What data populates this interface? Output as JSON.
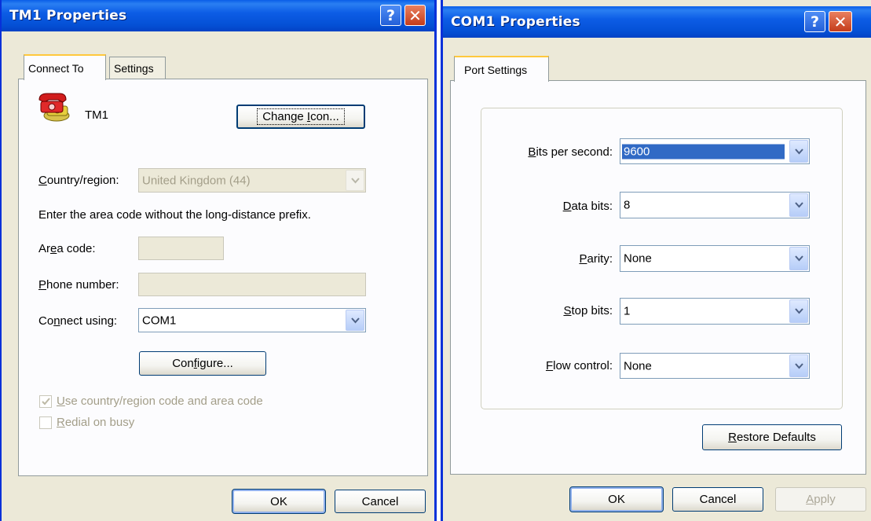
{
  "dialog1": {
    "title": "TM1 Properties",
    "tabs": [
      {
        "label": "Connect To",
        "active": true
      },
      {
        "label": "Settings",
        "active": false
      }
    ],
    "connection_name": "TM1",
    "icon": "telephone-icon",
    "change_icon": {
      "pre": "Change ",
      "u": "I",
      "post": "con..."
    },
    "country": {
      "u": "C",
      "rest": "ountry/region:",
      "value": "United Kingdom (44)"
    },
    "instruction": "Enter the area code without the long-distance prefix.",
    "area_code": {
      "pre": "Ar",
      "u": "e",
      "post": "a code:",
      "value": ""
    },
    "phone": {
      "u": "P",
      "rest": "hone number:",
      "value": ""
    },
    "connect_using": {
      "pre": "Co",
      "u": "n",
      "post": "nect using:",
      "value": "COM1"
    },
    "configure": {
      "pre": "Con",
      "u": "f",
      "post": "igure..."
    },
    "checkboxes": [
      {
        "u": "U",
        "rest": "se country/region code and area code",
        "checked": true
      },
      {
        "u": "R",
        "rest": "edial on busy",
        "checked": false
      }
    ],
    "ok": "OK",
    "cancel": "Cancel"
  },
  "dialog2": {
    "title": "COM1 Properties",
    "tab": "Port Settings",
    "fields": [
      {
        "u": "B",
        "rest": "its per second:",
        "value": "9600",
        "selected": true
      },
      {
        "u": "D",
        "rest": "ata bits:",
        "value": "8",
        "selected": false
      },
      {
        "u": "P",
        "rest": "arity:",
        "value": "None",
        "selected": false
      },
      {
        "u": "S",
        "rest": "top bits:",
        "value": "1",
        "selected": false
      },
      {
        "u": "F",
        "rest": "low control:",
        "value": "None",
        "selected": false
      }
    ],
    "restore": {
      "u": "R",
      "rest": "estore Defaults"
    },
    "ok": "OK",
    "cancel": "Cancel",
    "apply": {
      "u": "A",
      "rest": "pply"
    }
  },
  "titlebar_buttons": {
    "help": "?",
    "close": "✕"
  },
  "colors": {
    "titlebar": "#0450d5",
    "face": "#ece9d8",
    "tab_highlight": "#ffc83c",
    "selection": "#316ac5"
  }
}
